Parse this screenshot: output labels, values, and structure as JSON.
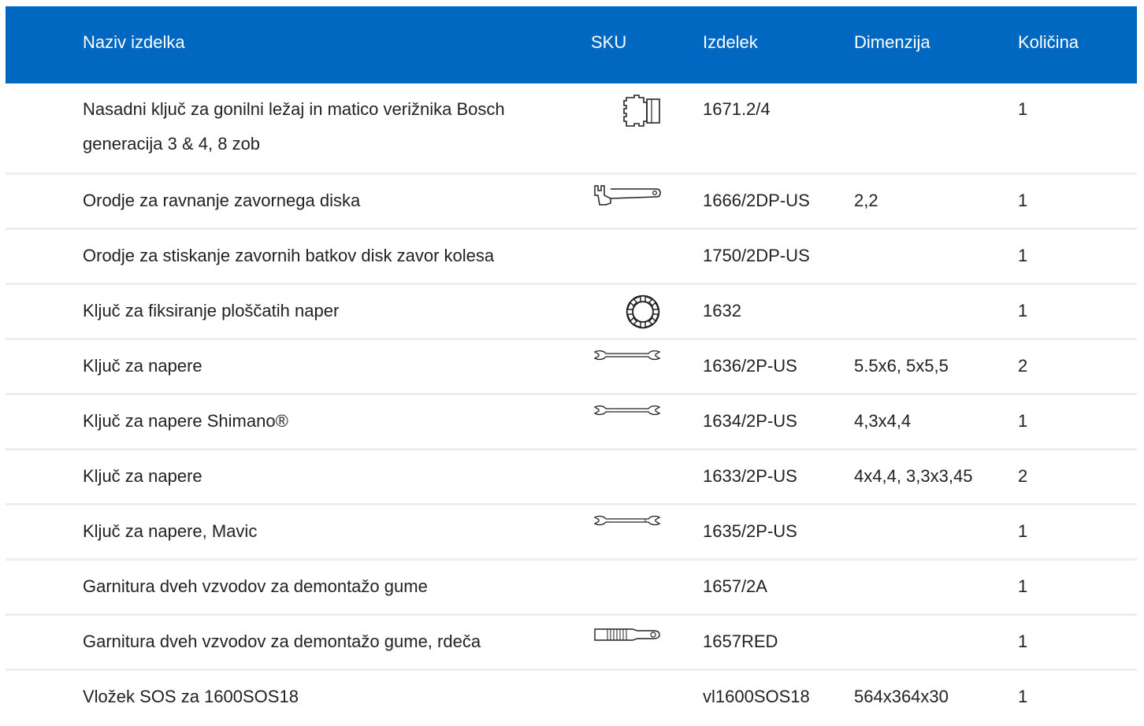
{
  "header": {
    "name": "Naziv izdelka",
    "sku": "SKU",
    "product": "Izdelek",
    "dimension": "Dimenzija",
    "quantity": "Količina"
  },
  "colors": {
    "header_bg": "#0068c0",
    "header_text": "#ffffff",
    "row_divider": "#eeeeee"
  },
  "rows": [
    {
      "name": "Nasadni ključ za gonilni ležaj in matico verižnika Bosch generacija 3 & 4, 8 zob",
      "icon": "socket-wrench-icon",
      "product": "1671.2/4",
      "dimension": "",
      "quantity": "1"
    },
    {
      "name": "Orodje za ravnanje zavornega diska",
      "icon": "disc-straightener-icon",
      "product": "1666/2DP-US",
      "dimension": "2,2",
      "quantity": "1"
    },
    {
      "name": "Orodje za stiskanje zavornih batkov disk zavor kolesa",
      "icon": "",
      "product": "1750/2DP-US",
      "dimension": "",
      "quantity": "1"
    },
    {
      "name": "Ključ za fiksiranje ploščatih naper",
      "icon": "spoke-holder-icon",
      "product": "1632",
      "dimension": "",
      "quantity": "1"
    },
    {
      "name": "Ključ za napere",
      "icon": "spoke-wrench-icon",
      "product": "1636/2P-US",
      "dimension": "5.5x6, 5x5,5",
      "quantity": "2"
    },
    {
      "name": "Ključ za napere Shimano®",
      "icon": "spoke-wrench-icon",
      "product": "1634/2P-US",
      "dimension": "4,3x4,4",
      "quantity": "1"
    },
    {
      "name": "Ključ za napere",
      "icon": "",
      "product": "1633/2P-US",
      "dimension": "4x4,4, 3,3x3,45",
      "quantity": "2"
    },
    {
      "name": "Ključ za napere, Mavic",
      "icon": "spoke-wrench-icon",
      "product": "1635/2P-US",
      "dimension": "",
      "quantity": "1"
    },
    {
      "name": "Garnitura dveh vzvodov za demontažo gume",
      "icon": "",
      "product": "1657/2A",
      "dimension": "",
      "quantity": "1"
    },
    {
      "name": "Garnitura dveh vzvodov za demontažo gume, rdeča",
      "icon": "tire-lever-icon",
      "product": "1657RED",
      "dimension": "",
      "quantity": "1"
    },
    {
      "name": "Vložek SOS za 1600SOS18",
      "icon": "",
      "product": "vl1600SOS18",
      "dimension": "564x364x30",
      "quantity": "1"
    }
  ]
}
